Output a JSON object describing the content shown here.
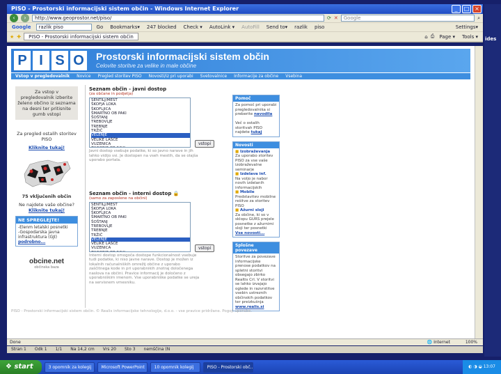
{
  "window": {
    "title": "PISO - Prostorski informacijski sistem občin - Windows Internet Explorer",
    "buttons": [
      "_",
      "□",
      "×"
    ]
  },
  "browser": {
    "address": "http://www.geoprostor.net/piso/",
    "search_placeholder": "Google",
    "google_bar": {
      "label": "Google",
      "query": "razlik piso",
      "items": [
        "Go",
        "Bookmarks▾",
        "247 blocked",
        "Check ▾",
        "AutoLink ▾",
        "AutoFill",
        "Send to▾",
        "razlik",
        "piso"
      ],
      "settings": "Settings▾"
    },
    "tab_label": "PISO - Prostorski informacijski sistem občin",
    "tools": [
      "Page ▾",
      "Tools ▾"
    ]
  },
  "site": {
    "logo_letters": [
      "P",
      "I",
      "S",
      "O"
    ],
    "title": "Prostorski informacijski sistem občin",
    "subtitle": "Celovite storitve za velike in male občine",
    "menu": [
      "Vstop v pregledovalnik",
      "Novice",
      "Pregled storitev PISO",
      "Novosti/iz pri uporabi",
      "Svetovalnice",
      "Informacije za občine",
      "Vsebina"
    ]
  },
  "left": {
    "intro": "Za vstop v pregledovalnik izberite želeno občino iz seznama na desni ter pritisnite gumb vstopi",
    "services_text": "Za pregled ostalih storitev PISO",
    "services_link": "Kliknite tukaj!",
    "count_text": "75 vključenih občin",
    "missing_text": "Ne najdete vaše občine?",
    "missing_link": "Kliknite tukaj!",
    "news_header": "NE SPREGLEJTE!",
    "news_items": [
      "-Elenm letalski posnetki",
      "-Gospodarska javna infrastruktura (GJI)"
    ],
    "news_more": "podrobno...",
    "brand": "obcine.net",
    "brand_sub": "občinska baza"
  },
  "public_list": {
    "title": "Seznam občin - javni dostop",
    "subtitle": "(za občane in podjetja)",
    "items": [
      "ŠENTILJ/MEST",
      "ŠKOFJA LOKA",
      "ŠKOFLJICA",
      "ŠMARTNO OB PAKI",
      "ŠOŠTANJ",
      "TREBOVLJE",
      "TREBNJE",
      "TRŽIČ",
      "VELENJE",
      "VELIKE LAŠČE",
      "VUZENICA",
      "ZAGORJE OB SAVI"
    ],
    "selected": "VELENJE",
    "button": "vstopi",
    "note": "Javni dostop vsebuje podatke, ki so javno narave in jih lahko vidijo vsi. Je dostopen na vseh mestih, da se olajša uporabo portala."
  },
  "internal_list": {
    "title": "Seznam občin - interni dostop",
    "subtitle": "(samo za zaposlene na občini)",
    "items": [
      "ŠENTILJ/MEST",
      "ŠKOFJA LOKA",
      "ŠKOFLJICA",
      "ŠMARTNO OB PAKI",
      "ŠOŠTANJ",
      "TREBOVLJE",
      "TREBNJE",
      "TRŽIČ",
      "VELENJE",
      "VELIKE LAŠČE",
      "VUZENICA",
      "ZAGORJE OB SAVI"
    ],
    "selected": "VELENJE",
    "button": "vstopi",
    "note": "Interni dostop omogoča dostope funkcionalnost vsebuje tudi podatke, ki niso javne narave. Dostop je možen iz lokalnih računalniških omrežij občine z uporabo zaščitnega kode in pri uporabnikih znotraj določenega naslova na občini. Pravice informacij je določeno z uporabniškim imenom. Vse uporabniške podatke se ureja na servisnem vmesniku."
  },
  "right": {
    "help": {
      "header": "Pomoč",
      "text1": "Za pomoč pri uporabi pregledovalnika si preberite",
      "link1": "navodila",
      "text2": "Več o ostalih storitvah PISO najdete",
      "link2": "tukaj"
    },
    "news": {
      "header": "Novosti",
      "items": [
        {
          "title": "Izobraževanja",
          "text": "Za uporabo storitev PISO za vse vaše izobraževalne seminarje"
        },
        {
          "title": "Izdelava inf.",
          "text": "Na voljo je nabor novih izdelanih informacijskih"
        },
        {
          "title": "Mobile",
          "text": "Predstavitev mobilne rešitve za storitev PISO"
        },
        {
          "title": "Ažurni sloji",
          "text": "Za občine, ki so v sklopu GURS prejele posnetke z ažurnimi sloji ter posnetki"
        }
      ],
      "more": "Vse novosti..."
    },
    "partners": {
      "header": "Splošne povezave",
      "text": "Storitve za povezave informacijske prenose podatkov na spletni storitvi obsegajo zbirko Realtis Crl. V storitvi se lahko izvajajo oglede in razvrstitve vsebin ustreznih občinskih podatkov ter preizkušnja",
      "link": "www.realis.si"
    }
  },
  "footer": "PISO - Prostorski informacijski sistem občin. © Realis informacijske tehnologije, d.o.o. - vse pravice pridržane. Pogoji uporabe.",
  "status": {
    "left": "Done",
    "zone": "Internet",
    "zoom": "100%"
  },
  "word_status": [
    "Stran 1",
    "Odk 1",
    "1/1",
    "Na 14,2 cm",
    "Vrs 20",
    "Sto 3",
    "nemščina (N"
  ],
  "taskbar": {
    "start": "start",
    "tasks": [
      "3 opomnik za kolegij",
      "Microsoft PowerPoint",
      "10 opomnik kolegij",
      "PISO - Prostorski obč..."
    ],
    "clock": "13:07"
  },
  "side_text": "ides"
}
